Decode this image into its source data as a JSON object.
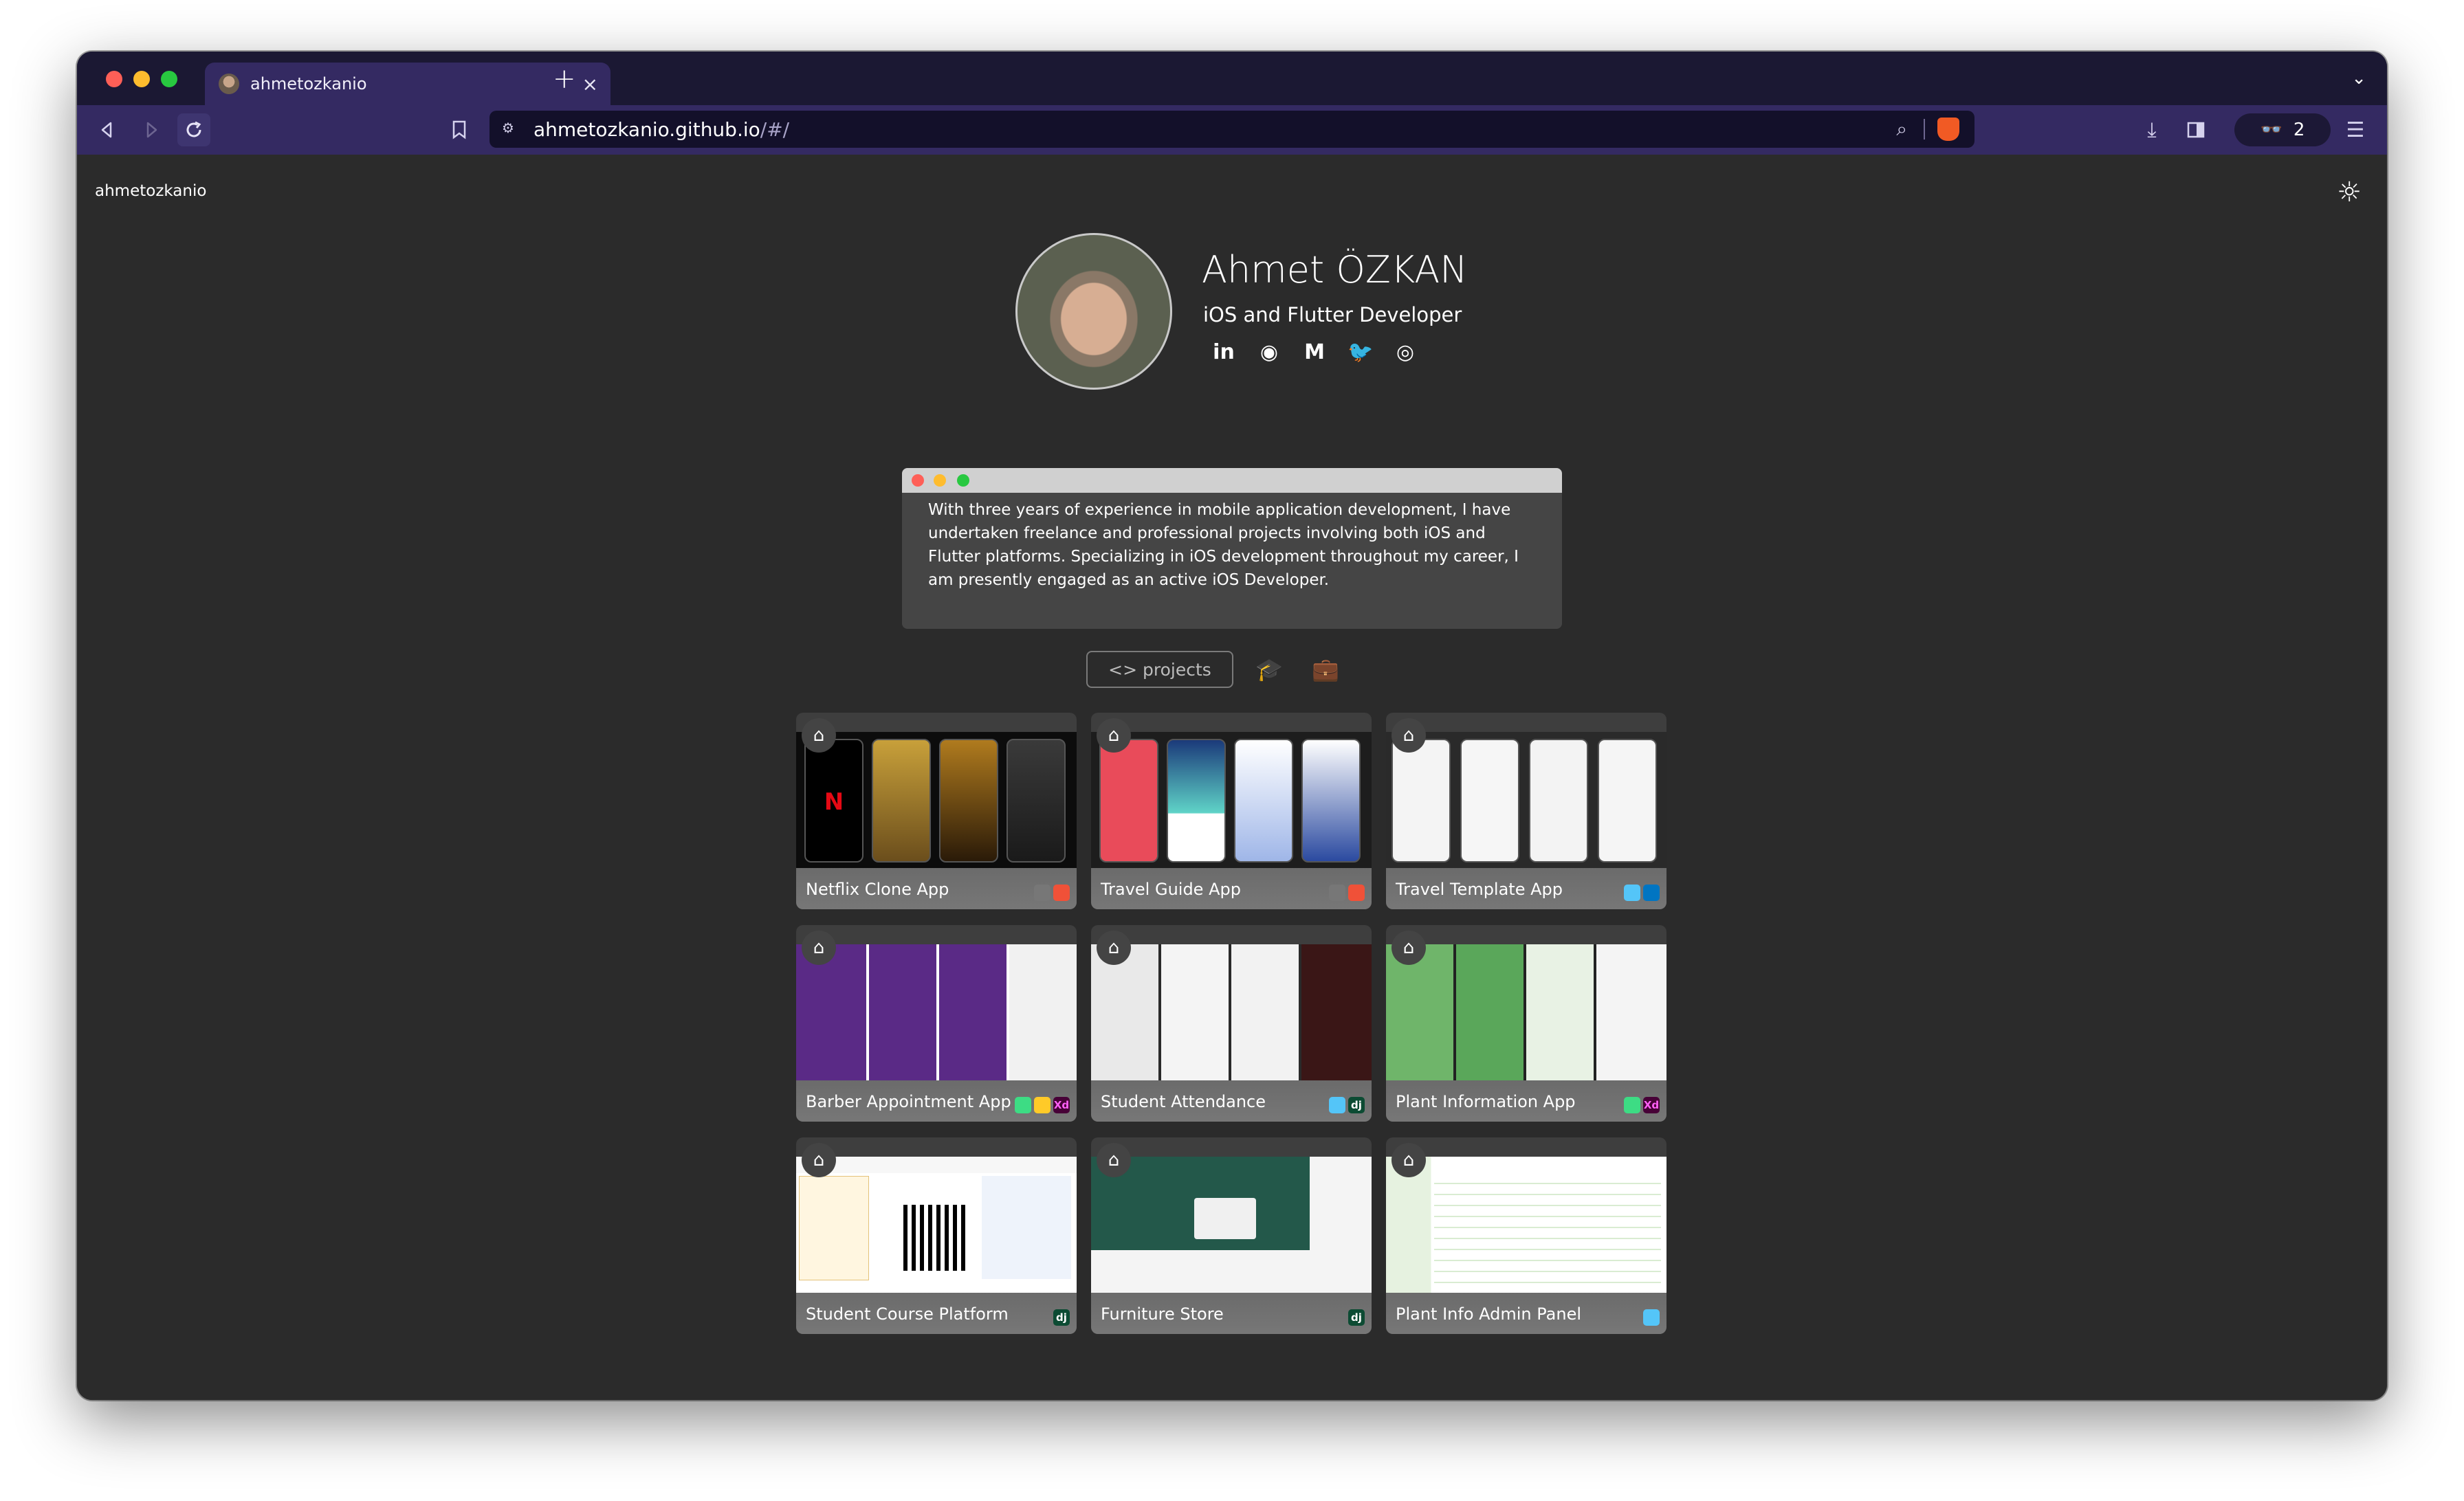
{
  "browser": {
    "tab_title": "ahmetozkanio",
    "tab_close": "×",
    "new_tab": "+",
    "tab_menu": "⌄",
    "url_host": "ahmetozkanio.github.io",
    "url_path": "/#/",
    "rewards_count": "2",
    "colors": {
      "chrome": "#1b1833",
      "toolbar": "#342a62",
      "urlbar": "#13102a"
    }
  },
  "site": {
    "logo": "ahmetozkanio",
    "theme_icon": "sun-icon"
  },
  "profile": {
    "name": "Ahmet ÖZKAN",
    "role": "iOS and Flutter Developer",
    "socials": [
      {
        "icon": "linkedin-icon",
        "glyph": "in"
      },
      {
        "icon": "github-icon",
        "glyph": "◉"
      },
      {
        "icon": "medium-icon",
        "glyph": "M"
      },
      {
        "icon": "twitter-icon",
        "glyph": "🐦"
      },
      {
        "icon": "instagram-icon",
        "glyph": "◎"
      }
    ]
  },
  "about": {
    "text": "With three years of experience in mobile application development, I have undertaken freelance and professional projects involving both iOS and Flutter platforms. Specializing in iOS development throughout my career, I am presently engaged as an active iOS Developer."
  },
  "section_tabs": {
    "projects_label": "<> projects",
    "education_icon": "graduation-cap-icon",
    "experience_icon": "briefcase-icon"
  },
  "projects": [
    {
      "title": "Netflix Clone App",
      "badges": [
        "apple",
        "swift"
      ]
    },
    {
      "title": "Travel Guide App",
      "badges": [
        "apple",
        "swift"
      ]
    },
    {
      "title": "Travel Template App",
      "badges": [
        "flutter",
        "dart"
      ]
    },
    {
      "title": "Barber Appointment App",
      "badges": [
        "android",
        "firebase",
        "xd"
      ]
    },
    {
      "title": "Student Attendance",
      "badges": [
        "flutter",
        "django"
      ]
    },
    {
      "title": "Plant Information App",
      "badges": [
        "android",
        "xd"
      ]
    },
    {
      "title": "Student Course Platform",
      "badges": [
        "django"
      ]
    },
    {
      "title": "Furniture Store",
      "badges": [
        "django"
      ]
    },
    {
      "title": "Plant Info Admin Panel",
      "badges": [
        "flutter"
      ]
    }
  ]
}
